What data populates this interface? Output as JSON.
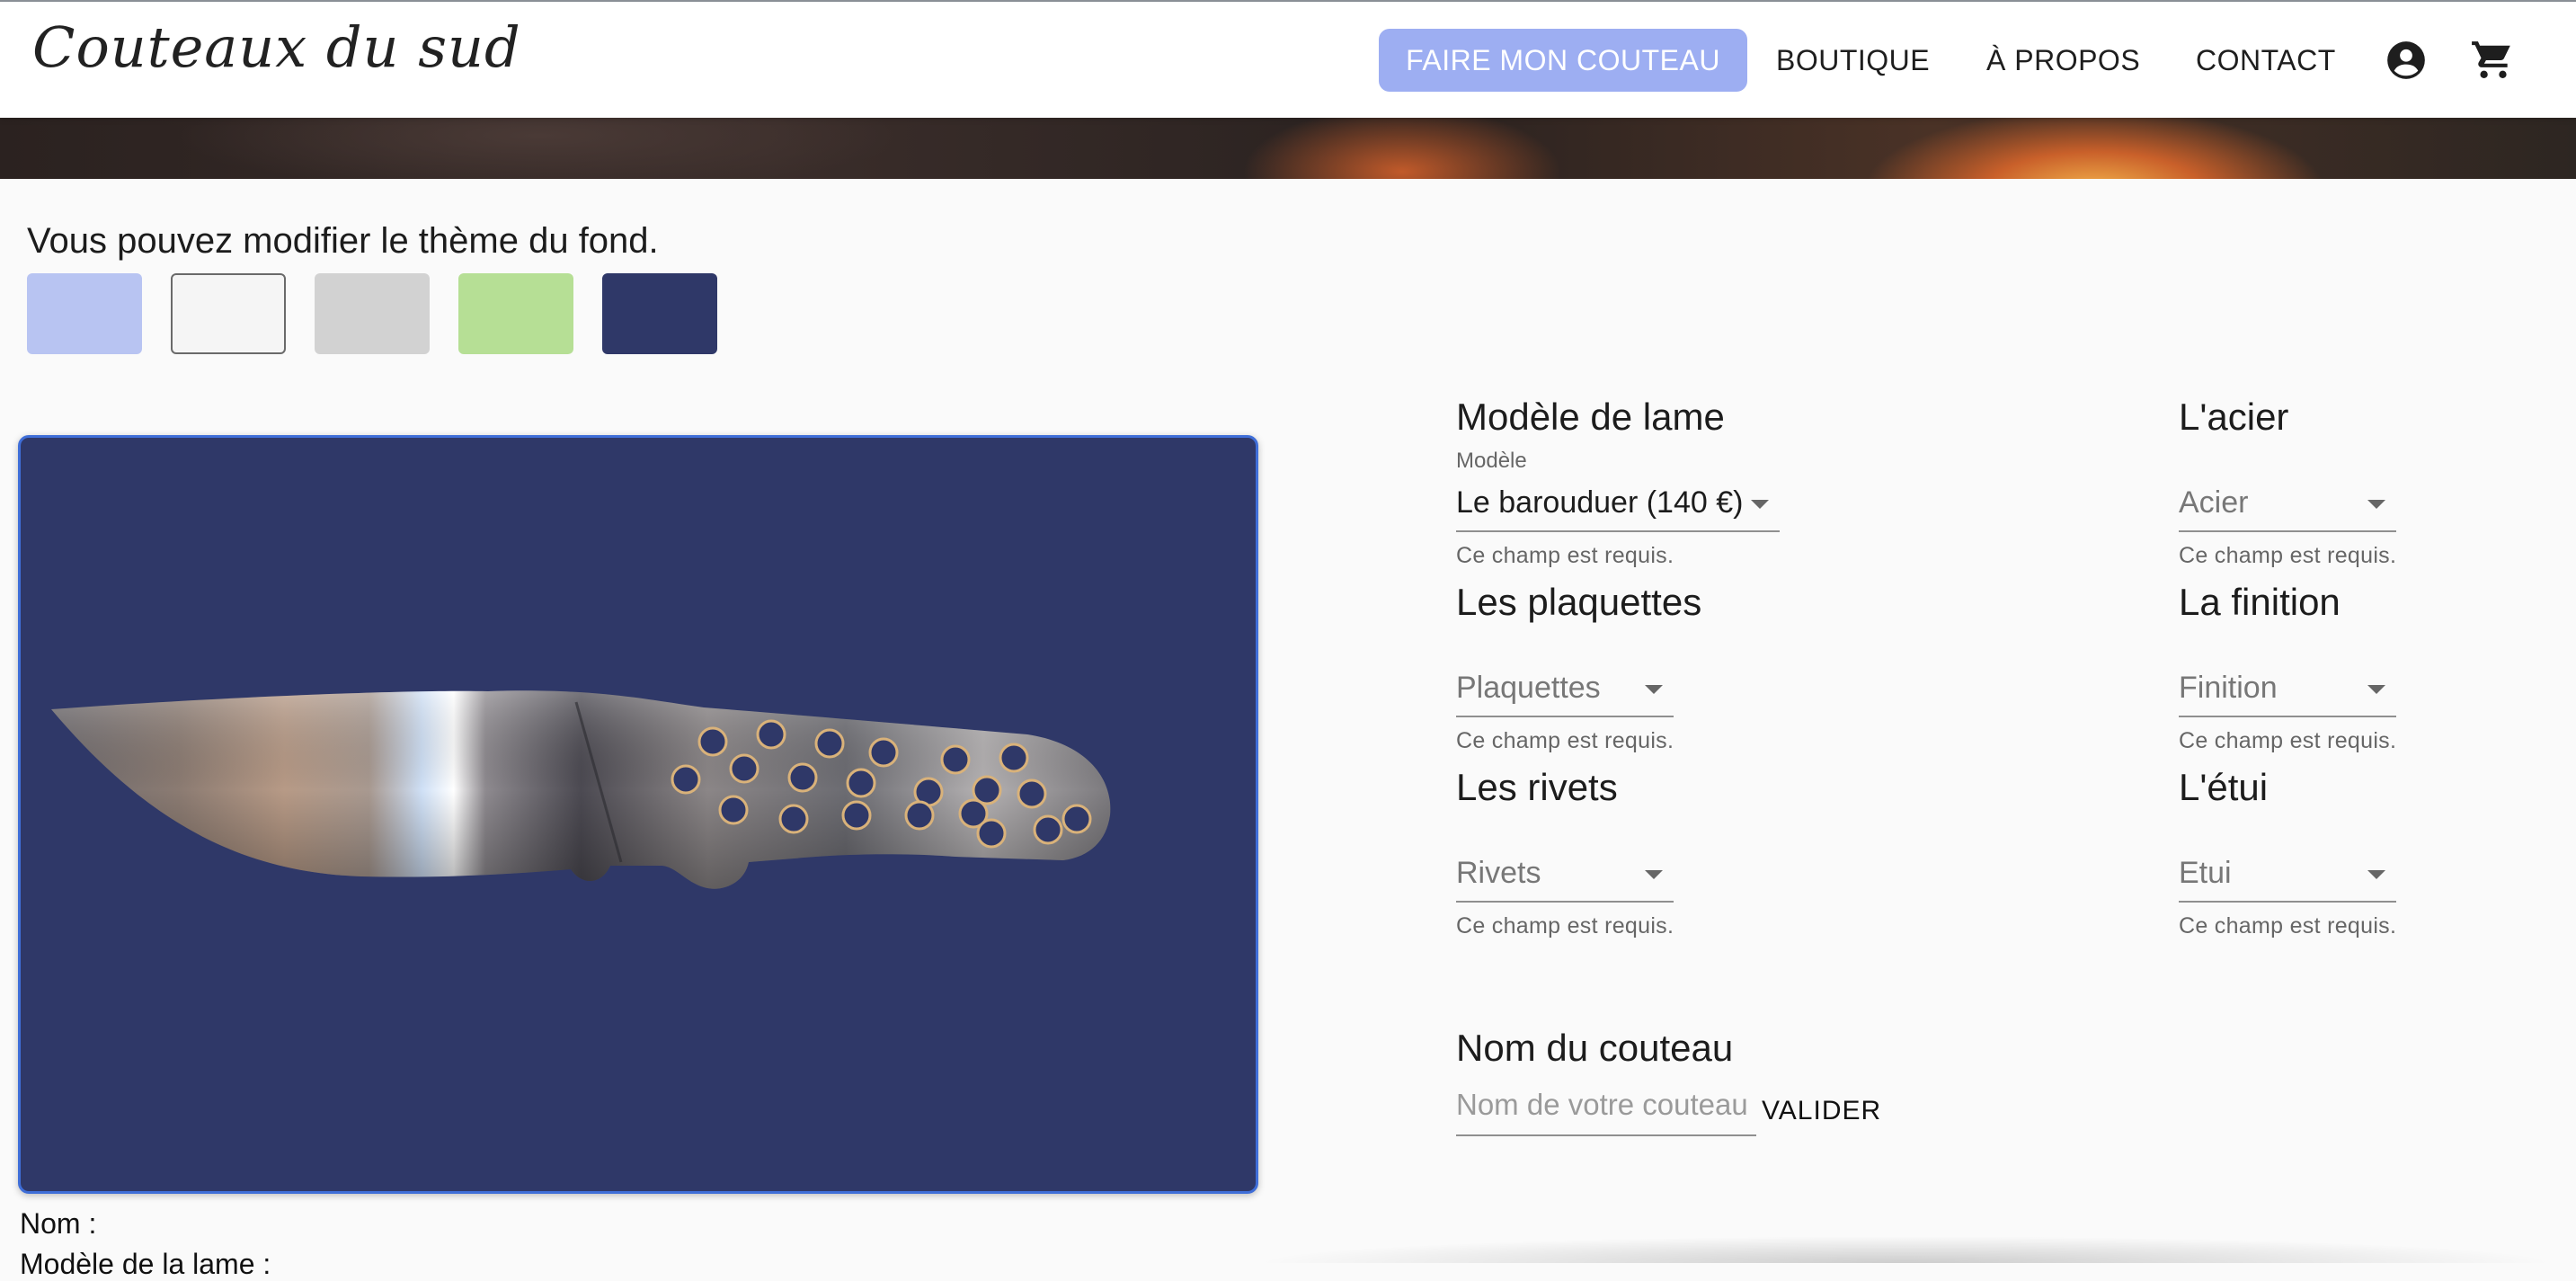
{
  "app": {
    "logo_text": "Couteaux du sud"
  },
  "nav": {
    "make_knife": "FAIRE MON COUTEAU",
    "shop": "BOUTIQUE",
    "about": "À PROPOS",
    "contact": "CONTACT",
    "account_icon": "account-circle-icon",
    "cart_icon": "shopping-cart-icon"
  },
  "colors": {
    "primary_button": "#9daef2",
    "swatches": [
      "#b8c4f2",
      "#f5f5f5",
      "#d2d2d2",
      "#b6df95",
      "#2f3868"
    ],
    "preview_background": "#2f3868",
    "preview_border": "#3f6ed8"
  },
  "theme": {
    "label": "Vous pouvez modifier le thème du fond."
  },
  "preview": {
    "image": "knife-blade-with-perforated-handle"
  },
  "form": {
    "blade_model": {
      "title": "Modèle de lame",
      "label": "Modèle",
      "value": "Le barouduer (140 €)",
      "helper": "Ce champ est requis."
    },
    "steel": {
      "title": "L'acier",
      "placeholder": "Acier",
      "helper": "Ce champ est requis."
    },
    "scales": {
      "title": "Les plaquettes",
      "placeholder": "Plaquettes",
      "helper": "Ce champ est requis."
    },
    "finish": {
      "title": "La finition",
      "placeholder": "Finition",
      "helper": "Ce champ est requis."
    },
    "rivets": {
      "title": "Les rivets",
      "placeholder": "Rivets",
      "helper": "Ce champ est requis."
    },
    "sheath": {
      "title": "L'étui",
      "placeholder": "Etui",
      "helper": "Ce champ est requis."
    },
    "knife_name": {
      "title": "Nom du couteau",
      "placeholder": "Nom de votre couteau",
      "submit": "VALIDER"
    }
  },
  "summary": {
    "name_label": "Nom :",
    "blade_label": "Modèle de la lame :"
  }
}
